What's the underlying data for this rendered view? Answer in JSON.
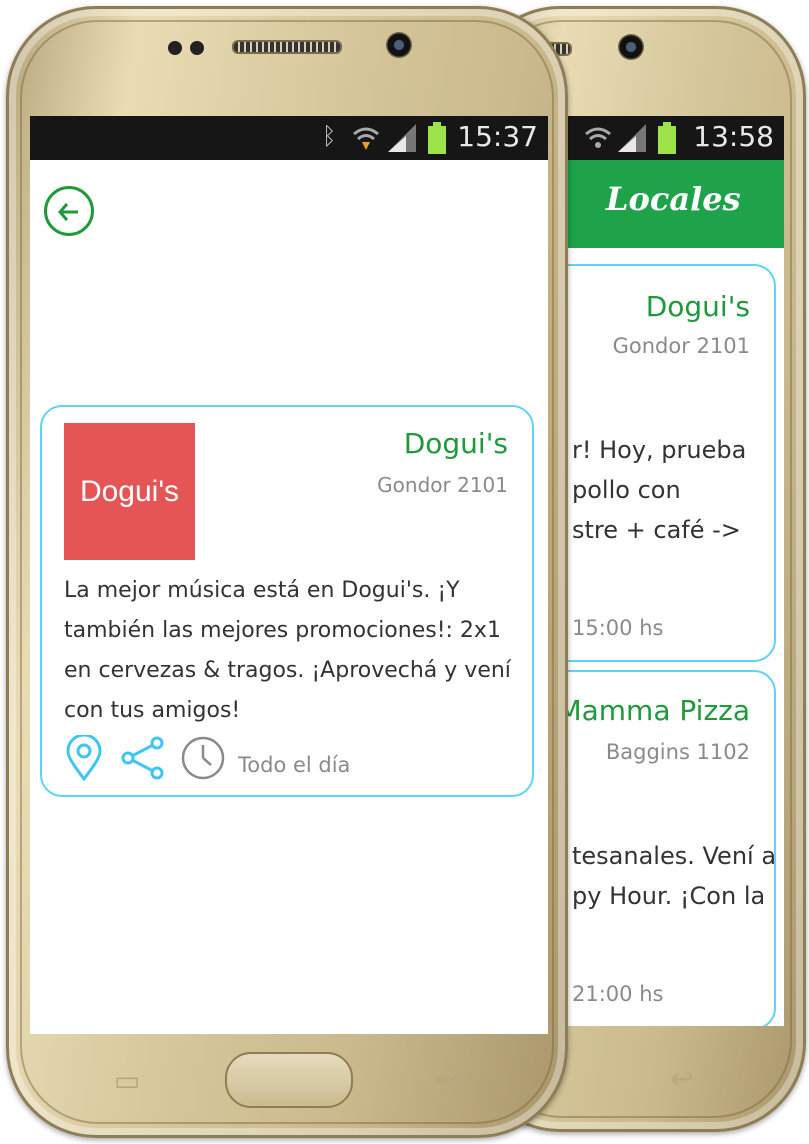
{
  "back_screen": {
    "status_time": "13:58",
    "header_title": "Locales",
    "cards": [
      {
        "name": "Dogui's",
        "address": "Gondor 2101",
        "lines": [
          "r! Hoy, prueba",
          "pollo con",
          "stre + café ->"
        ],
        "hours": "15:00 hs"
      },
      {
        "name": "Mamma Pizza",
        "address": "Baggins 1102",
        "lines": [
          "tesanales. Vení a",
          "py Hour. ¡Con la"
        ],
        "hours": "21:00 hs"
      }
    ]
  },
  "front_screen": {
    "status_time": "15:37",
    "venue": {
      "logo_text": "Dogui's",
      "name": "Dogui's",
      "address": "Gondor 2101",
      "description": "La mejor música está en Dogui's. ¡Y también las mejores promociones!: 2x1 en cervezas & tragos. ¡Aprovechá y vení con tus amigos!",
      "hours": "Todo el día"
    },
    "icons": [
      "back-arrow-icon",
      "location-pin-icon",
      "share-icon",
      "clock-icon"
    ]
  },
  "colors": {
    "accent_green": "#1ea24a",
    "card_border": "#5fd3f3",
    "logo_bg": "#e55556",
    "icon_blue": "#3ec6f0"
  }
}
